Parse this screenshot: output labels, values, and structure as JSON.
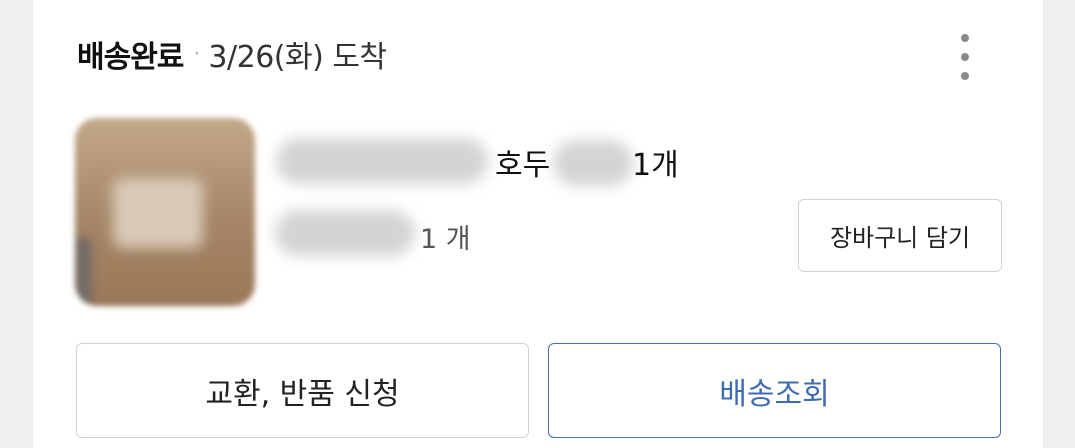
{
  "order": {
    "status": "배송완료",
    "separator": "·",
    "arrival": "3/26(화) 도착"
  },
  "icons": {
    "more": "more-vertical-icon"
  },
  "product": {
    "name_visible": "호두",
    "quantity": "1개",
    "option_quantity": "1 개"
  },
  "actions": {
    "add_to_cart": "장바구니 담기",
    "exchange_return": "교환, 반품 신청",
    "track_delivery": "배송조회"
  },
  "colors": {
    "track_accent": "#3f6bb0",
    "border": "#cfd2d6"
  }
}
